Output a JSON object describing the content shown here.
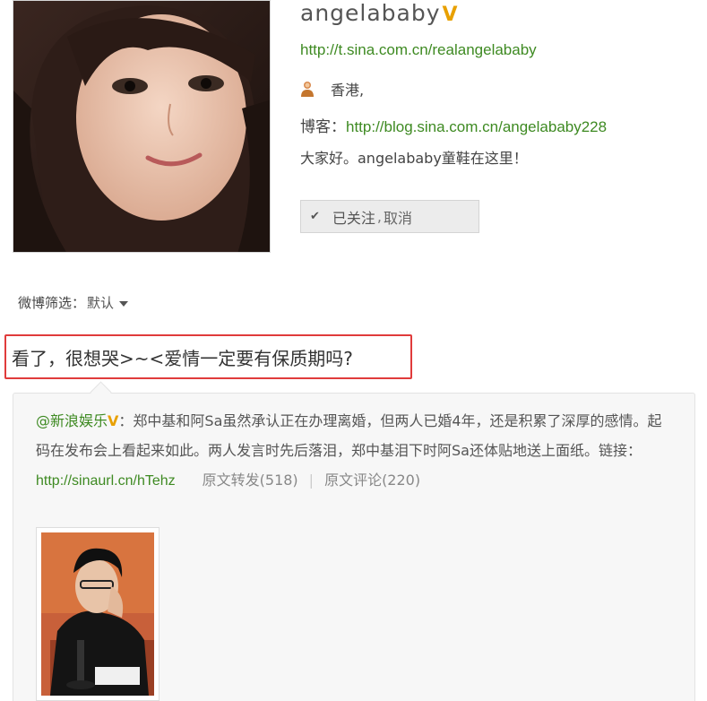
{
  "profile": {
    "name": "angelababy",
    "verified_mark": "V",
    "url": "http://t.sina.com.cn/realangelababy",
    "location": "香港,",
    "blog_label": "博客：",
    "blog_url": "http://blog.sina.com.cn/angelababy228",
    "bio": "大家好。angelababy童鞋在这里！",
    "follow_status": "已关注",
    "follow_separator": ",",
    "cancel_label": "取消"
  },
  "filter": {
    "label": "微博筛选：",
    "value": "默认"
  },
  "post": {
    "text": "看了，很想哭>~<爱情一定要有保质期吗?"
  },
  "repost": {
    "author": "@新浪娱乐",
    "author_verified": "V",
    "body": "：郑中基和阿Sa虽然承认正在办理离婚，但两人已婚4年，还是积累了深厚的感情。起码在发布会上看起来如此。两人发言时先后落泪，郑中基泪下时阿Sa还体贴地送上面纸。链接：",
    "link": "http://sinaurl.cn/hTehz",
    "repost_count": "原文转发(518)",
    "comment_count": "原文评论(220)",
    "divider": "|"
  },
  "colors": {
    "link_green": "#3e8a22",
    "verified_orange": "#e8a000",
    "highlight_red": "#e03b3b"
  },
  "icons": {
    "person": "person-icon",
    "check": "check-icon",
    "caret": "caret-down-icon"
  }
}
